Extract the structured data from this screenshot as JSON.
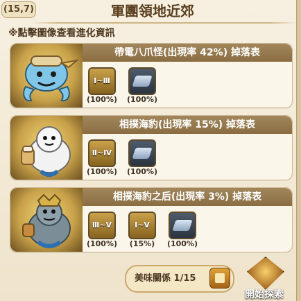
{
  "header": {
    "coordinate": "(15,7)",
    "title": "軍團領地近郊"
  },
  "hint_text": "※點擊圖像查看進化資訊",
  "cards": [
    {
      "monster_title": "帶電八爪怪(出現率 42%) 掉落表",
      "items": [
        {
          "kind": "scroll",
          "label": "Ⅰ~Ⅲ",
          "rate": "(100%)"
        },
        {
          "kind": "gem",
          "label": "",
          "rate": "(100%)"
        }
      ]
    },
    {
      "monster_title": "相撲海豹(出現率 15%) 掉落表",
      "items": [
        {
          "kind": "scroll",
          "label": "Ⅱ~Ⅳ",
          "rate": "(100%)"
        },
        {
          "kind": "gem",
          "label": "",
          "rate": "(100%)"
        }
      ]
    },
    {
      "monster_title": "相撲海豹之后(出現率 3%) 掉落表",
      "items": [
        {
          "kind": "scroll",
          "label": "Ⅲ~Ⅴ",
          "rate": "(100%)"
        },
        {
          "kind": "scroll",
          "label": "Ⅰ~Ⅴ",
          "rate": "(15%)"
        },
        {
          "kind": "gem",
          "label": "",
          "rate": "(100%)"
        }
      ]
    }
  ],
  "footer": {
    "delicacy_text": "美味關係 1/15",
    "explore_label": "開始探索"
  }
}
